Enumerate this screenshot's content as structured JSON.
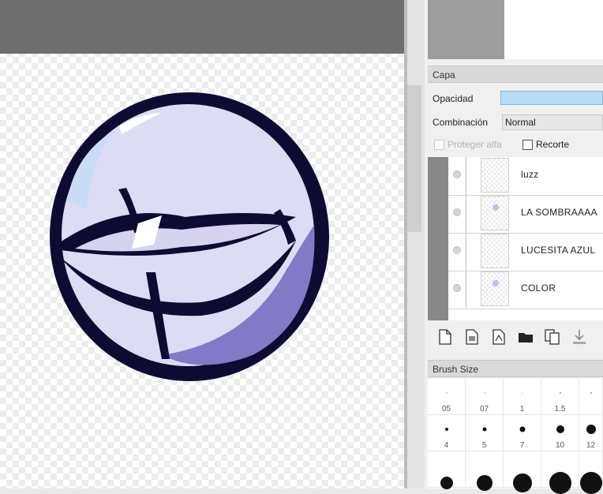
{
  "layer_panel": {
    "title": "Capa",
    "opacity_label": "Opacidad",
    "blend_label": "Combinación",
    "blend_mode": "Normal",
    "protect_alpha_label": "Proteger alfa",
    "clipping_label": "Recorte",
    "layers": [
      {
        "name": "luzz"
      },
      {
        "name": "LA  SOMBRAAAA"
      },
      {
        "name": "LUCESITA AZUL"
      },
      {
        "name": "COLOR"
      }
    ]
  },
  "brush_panel": {
    "title": "Brush Size",
    "row1_labels": [
      "05",
      "07",
      "1",
      "1.5",
      ""
    ],
    "row2_labels": [
      "4",
      "5",
      "7",
      "10",
      "12"
    ]
  },
  "toolbar_icons": [
    "new-layer-icon",
    "new-layer-copy-icon",
    "new-vector-layer-icon",
    "folder-icon",
    "duplicate-layer-icon",
    "merge-down-icon"
  ],
  "colors": {
    "canvas_topbar": "#6f6f6f",
    "opacity_bar": "#b9dcf3",
    "artwork_outline": "#0e0b33",
    "artwork_light": "#dcdcf4",
    "artwork_shadow": "#8479c6"
  }
}
